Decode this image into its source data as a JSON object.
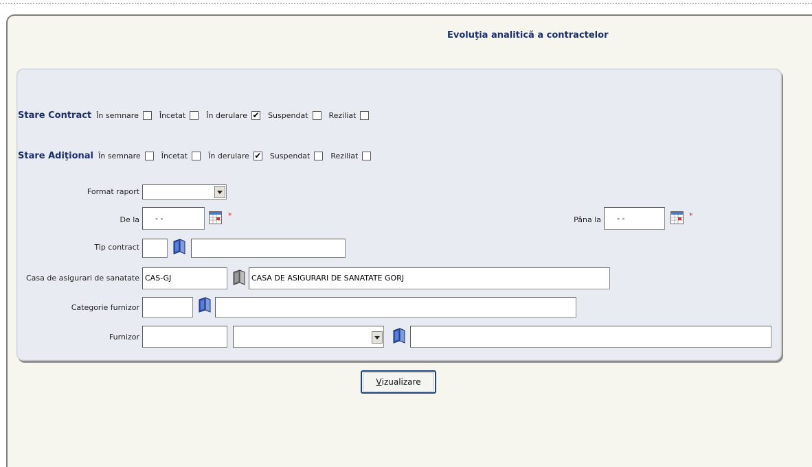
{
  "page": {
    "title": "Evoluţia analitică a contractelor"
  },
  "stare_contract": {
    "label": "Stare Contract",
    "options": [
      {
        "label": "În semnare",
        "checked": false
      },
      {
        "label": "Încetat",
        "checked": false
      },
      {
        "label": "În derulare",
        "checked": true
      },
      {
        "label": "Suspendat",
        "checked": false
      },
      {
        "label": "Reziliat",
        "checked": false
      }
    ]
  },
  "stare_aditional": {
    "label": "Stare Adiţional",
    "options": [
      {
        "label": "În semnare",
        "checked": false
      },
      {
        "label": "Încetat",
        "checked": false
      },
      {
        "label": "În derulare",
        "checked": true
      },
      {
        "label": "Suspendat",
        "checked": false
      },
      {
        "label": "Reziliat",
        "checked": false
      }
    ]
  },
  "form": {
    "format_raport": {
      "label": "Format raport",
      "value": ""
    },
    "de_la": {
      "label": "De la",
      "value": "  -  -",
      "required_mark": "*"
    },
    "pana_la": {
      "label": "Pâna la",
      "value": "  -  -",
      "required_mark": "*"
    },
    "tip_contract": {
      "label": "Tip contract",
      "code": "",
      "name": ""
    },
    "casa": {
      "label": "Casa de asigurari de sanatate",
      "code": "CAS-GJ",
      "name": "CASA DE ASIGURARI DE SANATATE GORJ"
    },
    "categorie_furnizor": {
      "label": "Categorie furnizor",
      "code": "",
      "name": ""
    },
    "furnizor": {
      "label": "Furnizor",
      "code": "",
      "select": "",
      "name": ""
    }
  },
  "actions": {
    "vizualizare_accesskey": "V",
    "vizualizare_rest": "izualizare"
  },
  "icons": {
    "calendar": "calendar-icon",
    "lookup": "book-lookup-icon",
    "dropdown": "chevron-down-icon"
  },
  "colors": {
    "heading": "#1c2f6b",
    "required": "#e02020",
    "panel": "#e8ebf1",
    "page": "#f6f6ee"
  }
}
